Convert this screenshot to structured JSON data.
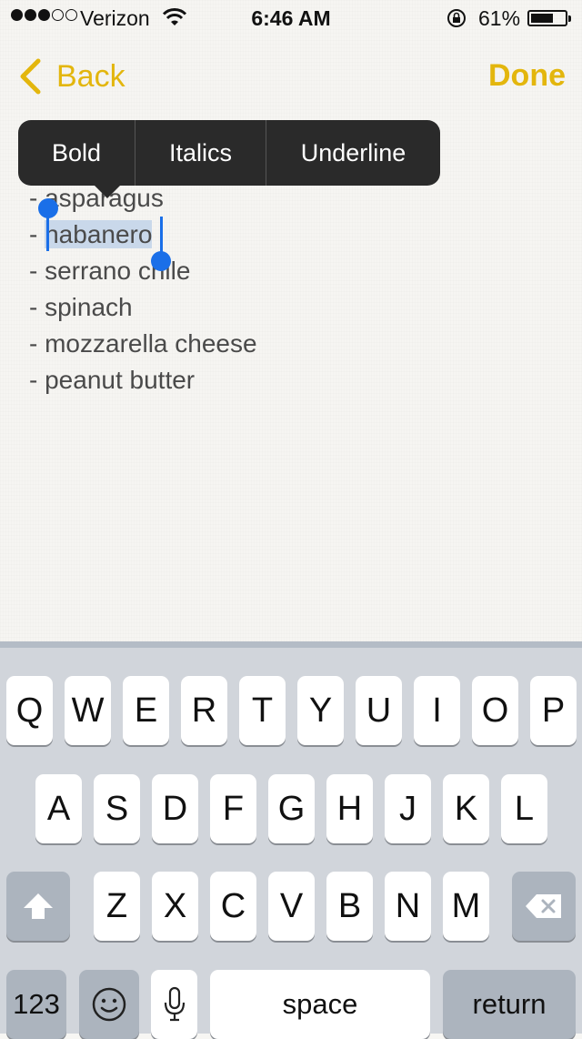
{
  "status": {
    "carrier": "Verizon",
    "time": "6:46 AM",
    "battery": "61%",
    "battery_level": 0.61
  },
  "nav": {
    "back_label": "Back",
    "done_label": "Done"
  },
  "popover": {
    "bold": "Bold",
    "italics": "Italics",
    "underline": "Underline"
  },
  "note": {
    "lines": [
      "- asparagus",
      "habanero",
      "- serrano chile",
      "- spinach",
      "- mozzarella cheese",
      "- peanut butter"
    ],
    "dash": "- "
  },
  "keyboard": {
    "row1": [
      "Q",
      "W",
      "E",
      "R",
      "T",
      "Y",
      "U",
      "I",
      "O",
      "P"
    ],
    "row2": [
      "A",
      "S",
      "D",
      "F",
      "G",
      "H",
      "J",
      "K",
      "L"
    ],
    "row3": [
      "Z",
      "X",
      "C",
      "V",
      "B",
      "N",
      "M"
    ],
    "numbers": "123",
    "space": "space",
    "return": "return"
  },
  "colors": {
    "accent": "#e3b60d",
    "selection": "#c9d8ea",
    "handle": "#1a6fe8"
  }
}
